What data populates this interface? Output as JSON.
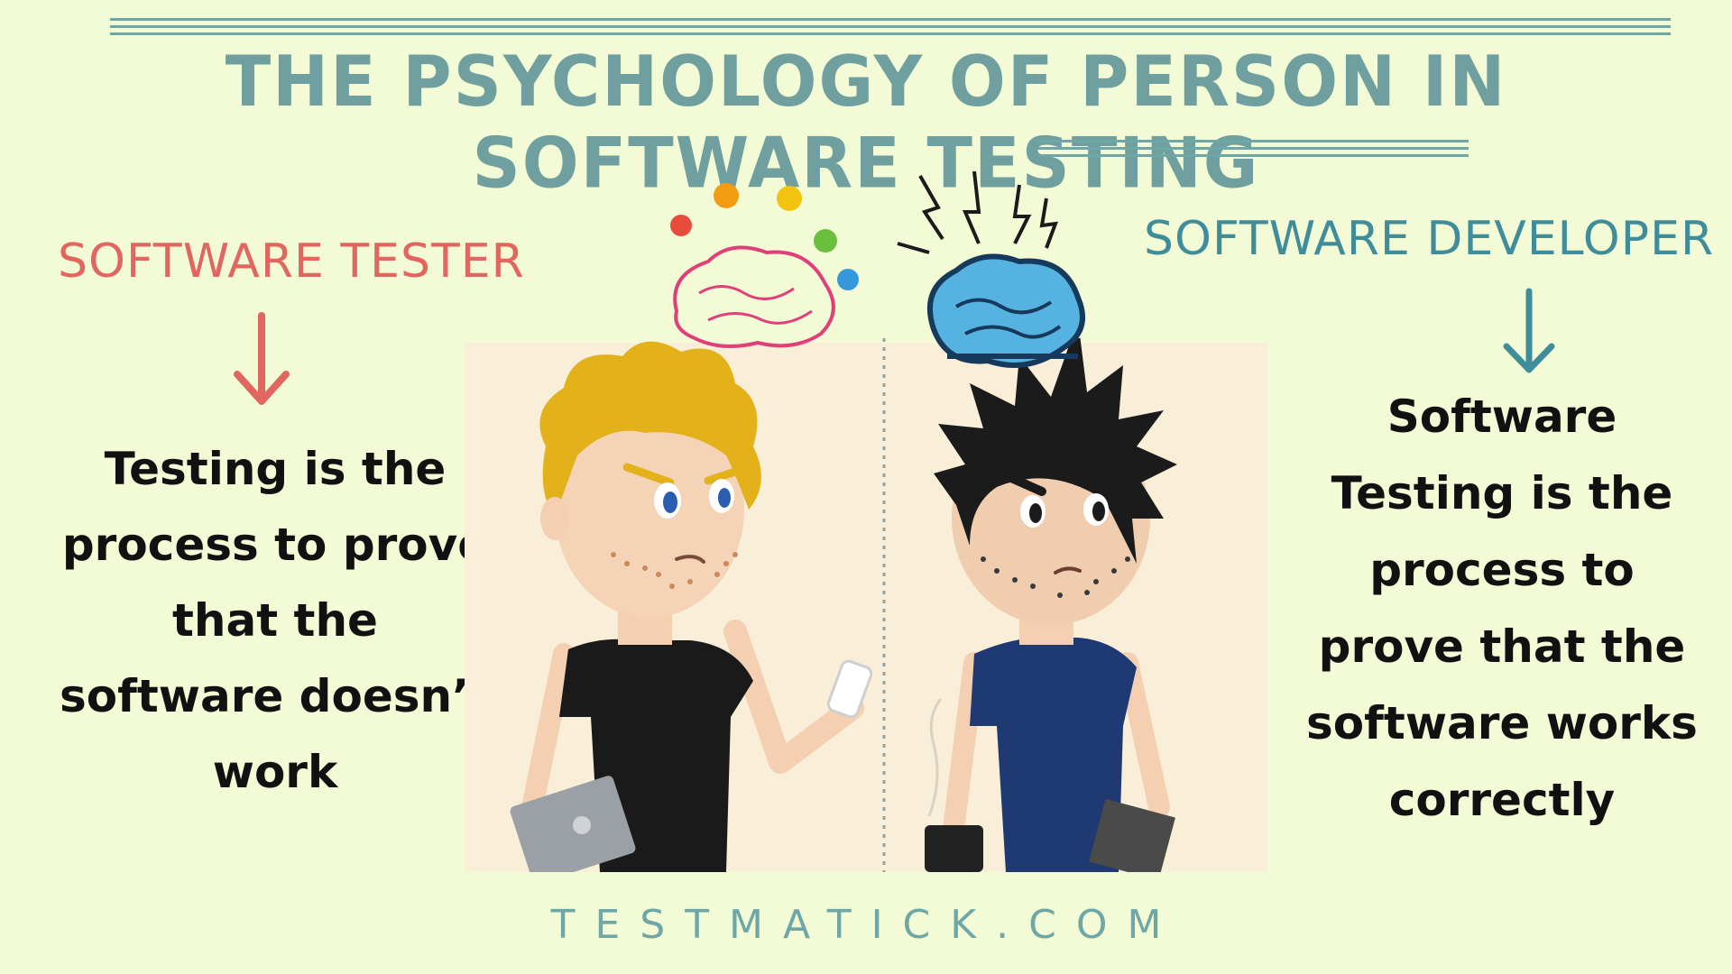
{
  "header": {
    "title": "THE PSYCHOLOGY OF PERSON IN SOFTWARE TESTING"
  },
  "tester": {
    "role": "SOFTWARE TESTER",
    "description": "Testing is the process to prove that the software doesn’t work",
    "color": "#e0665f"
  },
  "developer": {
    "role": "SOFTWARE DEVELOPER",
    "description": "Software Testing is the process to prove that the software works correctly",
    "color": "#3f8c9b"
  },
  "footer": {
    "site": "TESTMATICK.COM"
  },
  "icons": [
    "lightbulb-icon",
    "brain-icon",
    "lightning-icon",
    "down-arrow-icon",
    "laptop-icon",
    "phone-icon",
    "coffee-mug-icon"
  ],
  "colors": {
    "background": "#f3fbd6",
    "title": "#6f9f9f",
    "panel": "#f9efd9"
  }
}
